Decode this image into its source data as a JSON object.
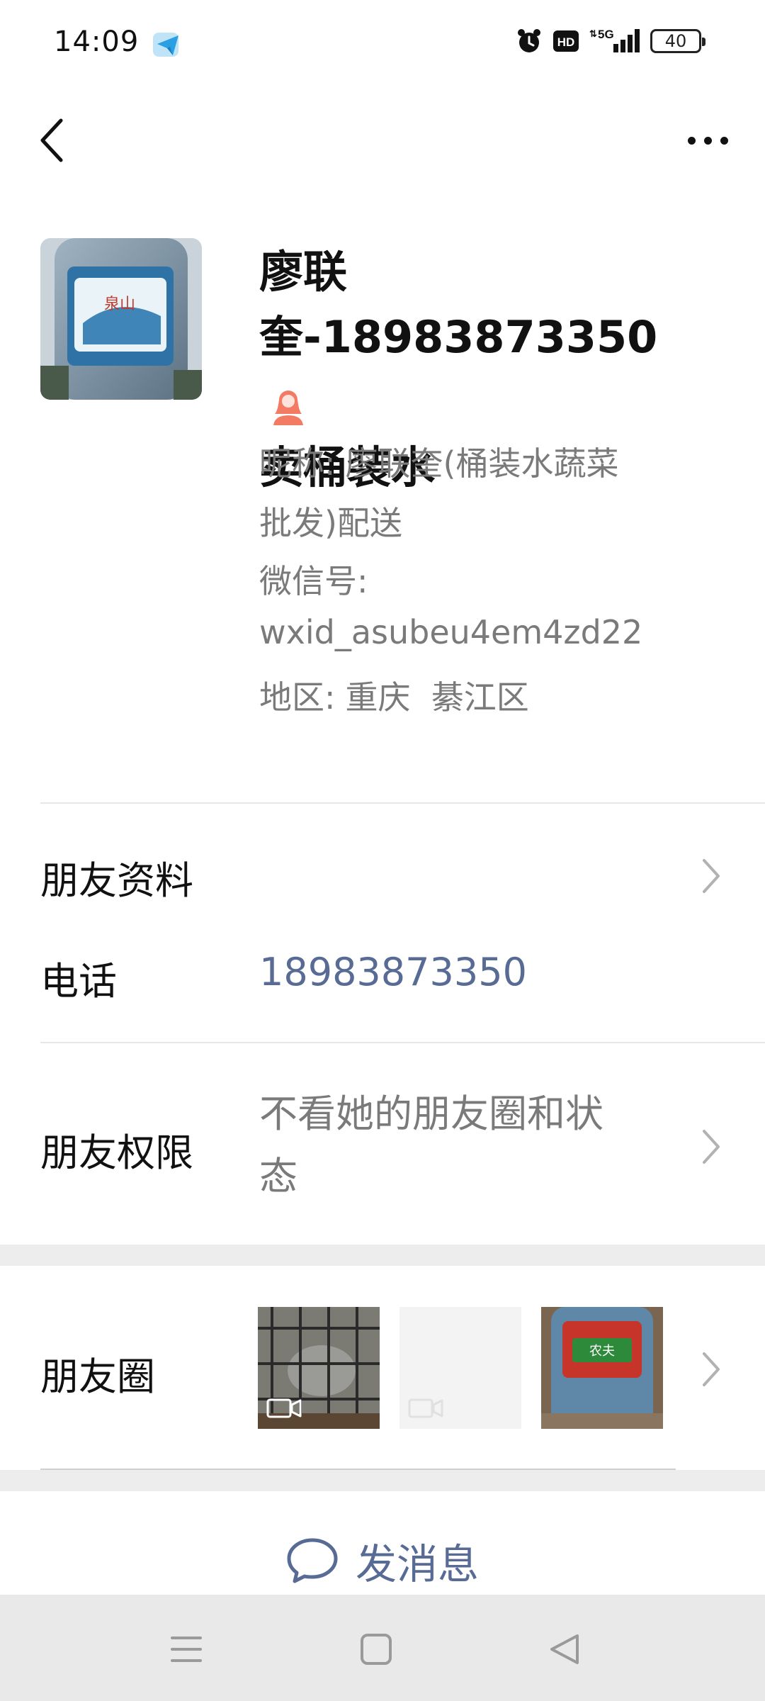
{
  "status_bar": {
    "time": "14:09",
    "network": "5G",
    "battery": "40",
    "icons": [
      "telegram-icon",
      "alarm-icon",
      "hd-icon",
      "signal-icon",
      "battery-icon"
    ]
  },
  "nav": {
    "back_icon": "chevron-left-icon",
    "more_icon": "more-icon"
  },
  "profile": {
    "name_lines": [
      "廖联",
      "奎-18983873350",
      "卖桶装水"
    ],
    "gender_icon": "female-icon",
    "gender_color": "#f37b63",
    "nickname_label": "昵称:",
    "nickname_value": "廖联奎(桶装水蔬菜",
    "nickname_value_2": "批发)配送",
    "wechat_id_label": "微信号:",
    "wechat_id_value": "wxid_asubeu4em4zd22",
    "region_label": "地区:",
    "region_value": "重庆  綦江区"
  },
  "rows": {
    "friend_info_label": "朋友资料",
    "phone_label": "电话",
    "phone_value": "18983873350",
    "permissions_label": "朋友权限",
    "permissions_value_1": "不看她的朋友圈和状",
    "permissions_value_2": "态",
    "moments_label": "朋友圈"
  },
  "actions": {
    "send_message": "发消息",
    "link_color": "#576b95"
  },
  "system_nav": {
    "icons": [
      "menu-icon",
      "home-icon",
      "back-triangle-icon"
    ]
  }
}
